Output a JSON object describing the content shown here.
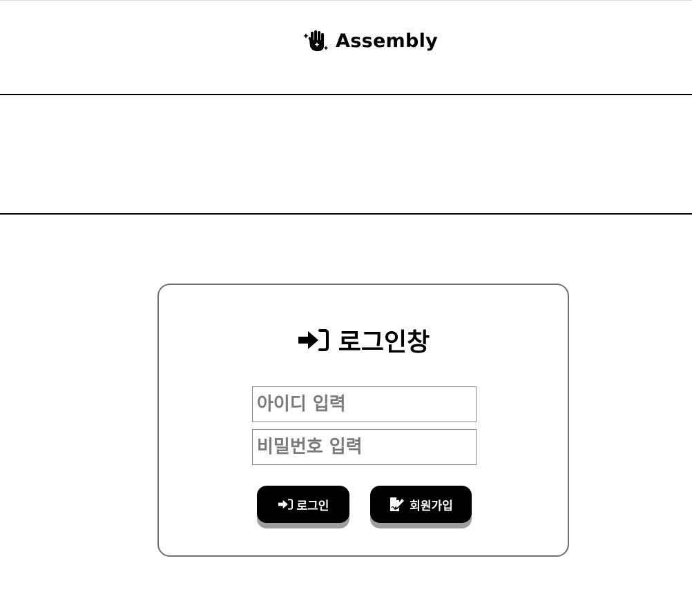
{
  "header": {
    "brand_name": "Assembly",
    "brand_icon": "sparkle-hand-icon"
  },
  "login": {
    "title": "로그인창",
    "title_icon": "sign-in-icon",
    "id_placeholder": "아이디 입력",
    "password_placeholder": "비밀번호 입력",
    "login_button": "로그인",
    "signup_button": "회원가입",
    "signup_icon": "signup-pen-icon"
  },
  "colors": {
    "background": "#ffffff",
    "text": "#000000",
    "card_border": "#707070",
    "button_bg": "#000000",
    "button_shadow": "#9e9e9e",
    "placeholder": "#7a7a7a"
  }
}
